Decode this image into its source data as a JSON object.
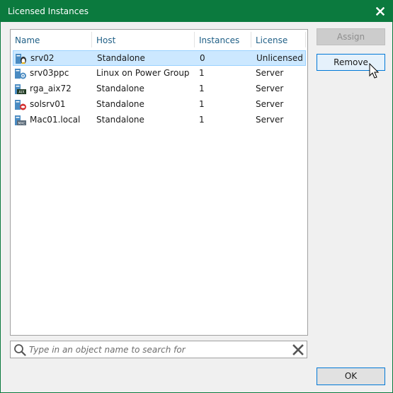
{
  "window": {
    "title": "Licensed Instances"
  },
  "table": {
    "columns": [
      "Name",
      "Host",
      "Instances",
      "License"
    ],
    "rows": [
      {
        "name": "srv02",
        "host": "Standalone",
        "instances": "0",
        "license": "Unlicensed",
        "icon": "linux-server-icon",
        "selected": true
      },
      {
        "name": "srv03ppc",
        "host": "Linux on Power Group",
        "instances": "1",
        "license": "Server",
        "icon": "power-server-icon",
        "selected": false
      },
      {
        "name": "rga_aix72",
        "host": "Standalone",
        "instances": "1",
        "license": "Server",
        "icon": "aix-server-icon",
        "selected": false
      },
      {
        "name": "solsrv01",
        "host": "Standalone",
        "instances": "1",
        "license": "Server",
        "icon": "solaris-server-icon",
        "selected": false
      },
      {
        "name": "Mac01.local",
        "host": "Standalone",
        "instances": "1",
        "license": "Server",
        "icon": "mac-server-icon",
        "selected": false
      }
    ]
  },
  "buttons": {
    "assign": "Assign",
    "remove": "Remove",
    "ok": "OK"
  },
  "search": {
    "placeholder": "Type in an object name to search for",
    "value": ""
  },
  "colors": {
    "titlebar": "#0b7a3e",
    "header_text": "#1f5f86",
    "selection": "#cce8ff",
    "focus_border": "#0078d7"
  }
}
